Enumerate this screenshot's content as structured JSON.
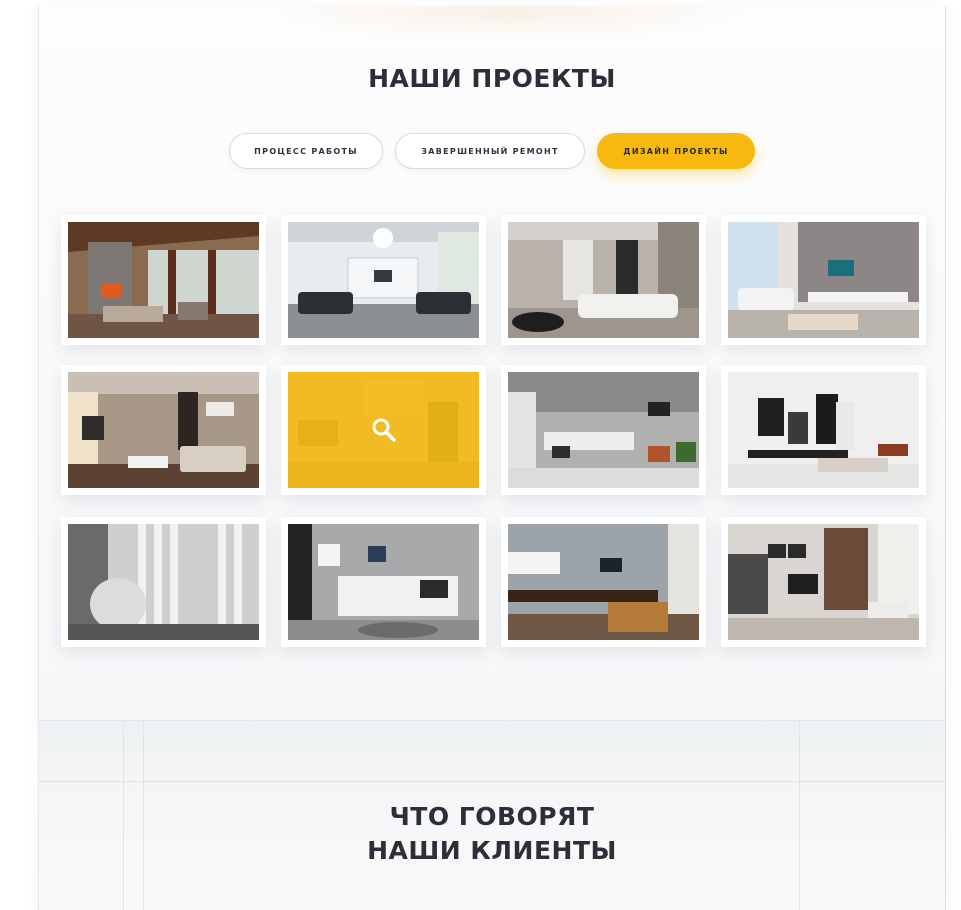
{
  "projects": {
    "title": "НАШИ ПРОЕКТЫ",
    "tabs": [
      {
        "label": "ПРОЦЕСС РАБОТЫ",
        "active": false
      },
      {
        "label": "ЗАВЕРШЕННЫЙ РЕМОНТ",
        "active": false
      },
      {
        "label": "ДИЗАЙН ПРОЕКТЫ",
        "active": true
      }
    ],
    "hovered_item_icon": "search-icon",
    "colors": {
      "accent": "#f7b90f",
      "title": "#2c2f3a"
    }
  },
  "testimonials": {
    "title_line1": "ЧТО ГОВОРЯТ",
    "title_line2": "НАШИ КЛИЕНТЫ"
  }
}
